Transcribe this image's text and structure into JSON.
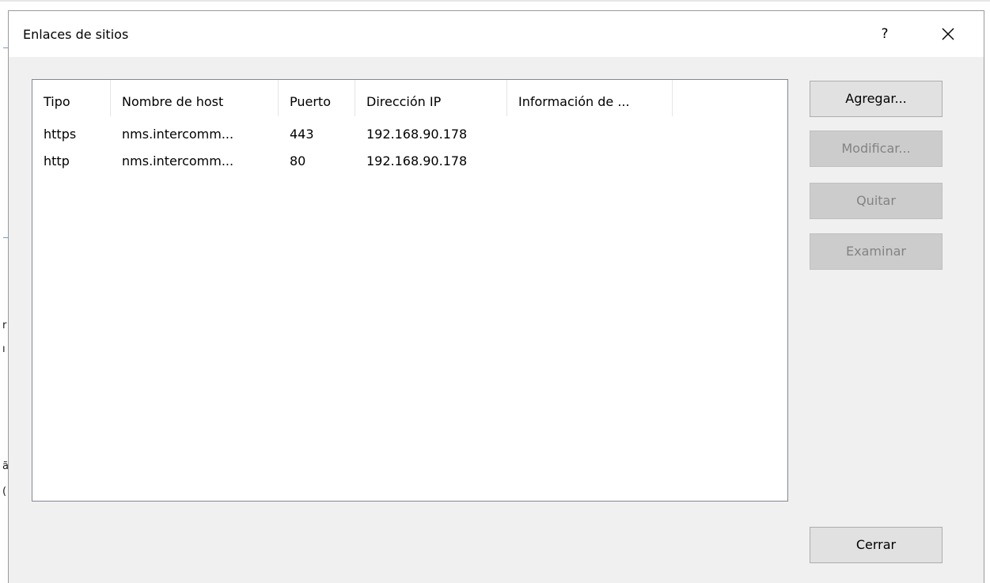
{
  "dialog": {
    "title": "Enlaces de sitios",
    "help_label": "?",
    "close_icon": "close-icon"
  },
  "table": {
    "columns": [
      "Tipo",
      "Nombre de host",
      "Puerto",
      "Dirección IP",
      "Información de ..."
    ],
    "rows": [
      [
        "https",
        "nms.intercomm...",
        "443",
        "192.168.90.178",
        ""
      ],
      [
        "http",
        "nms.intercomm...",
        "80",
        "192.168.90.178",
        ""
      ]
    ]
  },
  "buttons": {
    "add": "Agregar...",
    "edit": "Modificar...",
    "remove": "Quitar",
    "browse": "Examinar",
    "close": "Cerrar"
  },
  "colors": {
    "dialog_bg": "#f0f0f0",
    "titlebar_bg": "#ffffff",
    "disabled_button_bg": "#cccccc",
    "disabled_text": "#838383"
  }
}
